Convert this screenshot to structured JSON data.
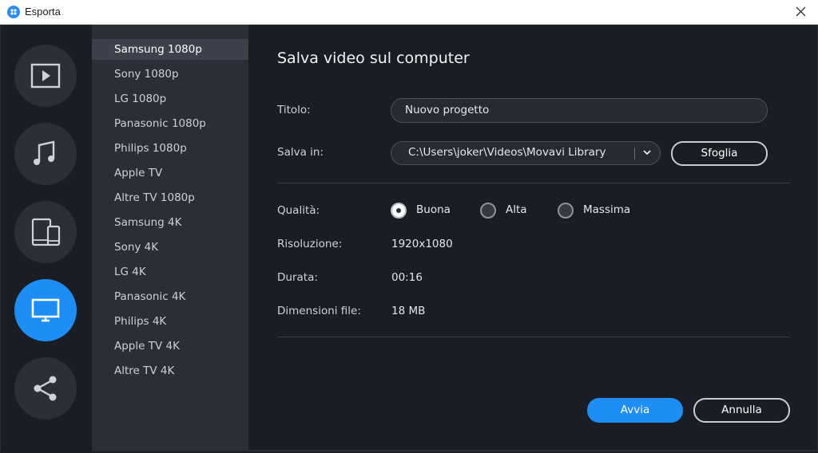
{
  "window": {
    "title": "Esporta"
  },
  "rail": [
    {
      "name": "video",
      "icon": "play-video-icon"
    },
    {
      "name": "audio",
      "icon": "music-note-icon"
    },
    {
      "name": "devices",
      "icon": "tablet-phone-icon"
    },
    {
      "name": "tv",
      "icon": "monitor-icon",
      "active": true
    },
    {
      "name": "share",
      "icon": "share-icon"
    }
  ],
  "presets": [
    "Samsung 1080p",
    "Sony 1080p",
    "LG 1080p",
    "Panasonic 1080p",
    "Philips 1080p",
    "Apple TV",
    "Altre TV 1080p",
    "Samsung 4K",
    "Sony 4K",
    "LG 4K",
    "Panasonic 4K",
    "Philips 4K",
    "Apple TV 4K",
    "Altre TV 4K"
  ],
  "selected_preset": "Samsung 1080p",
  "main": {
    "heading": "Salva video sul computer",
    "title_label": "Titolo:",
    "title_value": "Nuovo progetto",
    "save_label": "Salva in:",
    "save_path": "C:\\Users\\joker\\Videos\\Movavi Library",
    "browse_label": "Sfoglia",
    "quality_label": "Qualità:",
    "quality_options": [
      "Buona",
      "Alta",
      "Massima"
    ],
    "quality_selected": "Buona",
    "resolution_label": "Risoluzione:",
    "resolution_value": "1920x1080",
    "duration_label": "Durata:",
    "duration_value": "00:16",
    "filesize_label": "Dimensioni file:",
    "filesize_value": "18 MB",
    "start_label": "Avvia",
    "cancel_label": "Annulla"
  },
  "colors": {
    "accent": "#1c8ef5",
    "background": "#1a1d24",
    "panel": "#2a2e37"
  }
}
